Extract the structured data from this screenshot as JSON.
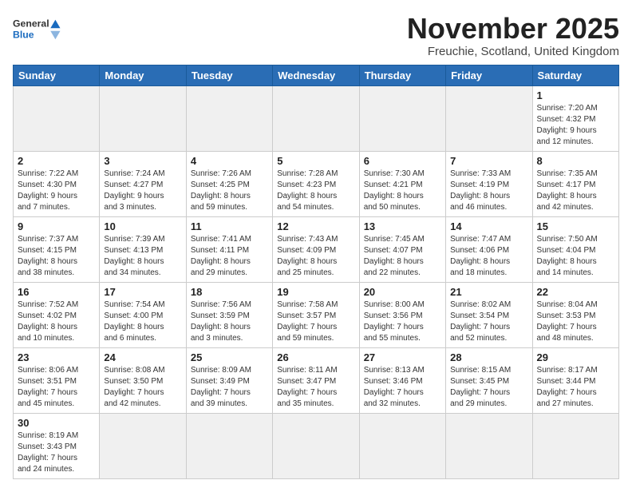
{
  "header": {
    "logo_text_regular": "General",
    "logo_text_blue": "Blue",
    "month_title": "November 2025",
    "location": "Freuchie, Scotland, United Kingdom"
  },
  "weekdays": [
    "Sunday",
    "Monday",
    "Tuesday",
    "Wednesday",
    "Thursday",
    "Friday",
    "Saturday"
  ],
  "days": [
    {
      "date": "",
      "info": ""
    },
    {
      "date": "",
      "info": ""
    },
    {
      "date": "",
      "info": ""
    },
    {
      "date": "",
      "info": ""
    },
    {
      "date": "",
      "info": ""
    },
    {
      "date": "",
      "info": ""
    },
    {
      "date": "1",
      "info": "Sunrise: 7:20 AM\nSunset: 4:32 PM\nDaylight: 9 hours\nand 12 minutes."
    },
    {
      "date": "2",
      "info": "Sunrise: 7:22 AM\nSunset: 4:30 PM\nDaylight: 9 hours\nand 7 minutes."
    },
    {
      "date": "3",
      "info": "Sunrise: 7:24 AM\nSunset: 4:27 PM\nDaylight: 9 hours\nand 3 minutes."
    },
    {
      "date": "4",
      "info": "Sunrise: 7:26 AM\nSunset: 4:25 PM\nDaylight: 8 hours\nand 59 minutes."
    },
    {
      "date": "5",
      "info": "Sunrise: 7:28 AM\nSunset: 4:23 PM\nDaylight: 8 hours\nand 54 minutes."
    },
    {
      "date": "6",
      "info": "Sunrise: 7:30 AM\nSunset: 4:21 PM\nDaylight: 8 hours\nand 50 minutes."
    },
    {
      "date": "7",
      "info": "Sunrise: 7:33 AM\nSunset: 4:19 PM\nDaylight: 8 hours\nand 46 minutes."
    },
    {
      "date": "8",
      "info": "Sunrise: 7:35 AM\nSunset: 4:17 PM\nDaylight: 8 hours\nand 42 minutes."
    },
    {
      "date": "9",
      "info": "Sunrise: 7:37 AM\nSunset: 4:15 PM\nDaylight: 8 hours\nand 38 minutes."
    },
    {
      "date": "10",
      "info": "Sunrise: 7:39 AM\nSunset: 4:13 PM\nDaylight: 8 hours\nand 34 minutes."
    },
    {
      "date": "11",
      "info": "Sunrise: 7:41 AM\nSunset: 4:11 PM\nDaylight: 8 hours\nand 29 minutes."
    },
    {
      "date": "12",
      "info": "Sunrise: 7:43 AM\nSunset: 4:09 PM\nDaylight: 8 hours\nand 25 minutes."
    },
    {
      "date": "13",
      "info": "Sunrise: 7:45 AM\nSunset: 4:07 PM\nDaylight: 8 hours\nand 22 minutes."
    },
    {
      "date": "14",
      "info": "Sunrise: 7:47 AM\nSunset: 4:06 PM\nDaylight: 8 hours\nand 18 minutes."
    },
    {
      "date": "15",
      "info": "Sunrise: 7:50 AM\nSunset: 4:04 PM\nDaylight: 8 hours\nand 14 minutes."
    },
    {
      "date": "16",
      "info": "Sunrise: 7:52 AM\nSunset: 4:02 PM\nDaylight: 8 hours\nand 10 minutes."
    },
    {
      "date": "17",
      "info": "Sunrise: 7:54 AM\nSunset: 4:00 PM\nDaylight: 8 hours\nand 6 minutes."
    },
    {
      "date": "18",
      "info": "Sunrise: 7:56 AM\nSunset: 3:59 PM\nDaylight: 8 hours\nand 3 minutes."
    },
    {
      "date": "19",
      "info": "Sunrise: 7:58 AM\nSunset: 3:57 PM\nDaylight: 7 hours\nand 59 minutes."
    },
    {
      "date": "20",
      "info": "Sunrise: 8:00 AM\nSunset: 3:56 PM\nDaylight: 7 hours\nand 55 minutes."
    },
    {
      "date": "21",
      "info": "Sunrise: 8:02 AM\nSunset: 3:54 PM\nDaylight: 7 hours\nand 52 minutes."
    },
    {
      "date": "22",
      "info": "Sunrise: 8:04 AM\nSunset: 3:53 PM\nDaylight: 7 hours\nand 48 minutes."
    },
    {
      "date": "23",
      "info": "Sunrise: 8:06 AM\nSunset: 3:51 PM\nDaylight: 7 hours\nand 45 minutes."
    },
    {
      "date": "24",
      "info": "Sunrise: 8:08 AM\nSunset: 3:50 PM\nDaylight: 7 hours\nand 42 minutes."
    },
    {
      "date": "25",
      "info": "Sunrise: 8:09 AM\nSunset: 3:49 PM\nDaylight: 7 hours\nand 39 minutes."
    },
    {
      "date": "26",
      "info": "Sunrise: 8:11 AM\nSunset: 3:47 PM\nDaylight: 7 hours\nand 35 minutes."
    },
    {
      "date": "27",
      "info": "Sunrise: 8:13 AM\nSunset: 3:46 PM\nDaylight: 7 hours\nand 32 minutes."
    },
    {
      "date": "28",
      "info": "Sunrise: 8:15 AM\nSunset: 3:45 PM\nDaylight: 7 hours\nand 29 minutes."
    },
    {
      "date": "29",
      "info": "Sunrise: 8:17 AM\nSunset: 3:44 PM\nDaylight: 7 hours\nand 27 minutes."
    },
    {
      "date": "30",
      "info": "Sunrise: 8:19 AM\nSunset: 3:43 PM\nDaylight: 7 hours\nand 24 minutes."
    },
    {
      "date": "",
      "info": ""
    },
    {
      "date": "",
      "info": ""
    },
    {
      "date": "",
      "info": ""
    },
    {
      "date": "",
      "info": ""
    },
    {
      "date": "",
      "info": ""
    },
    {
      "date": "",
      "info": ""
    }
  ]
}
